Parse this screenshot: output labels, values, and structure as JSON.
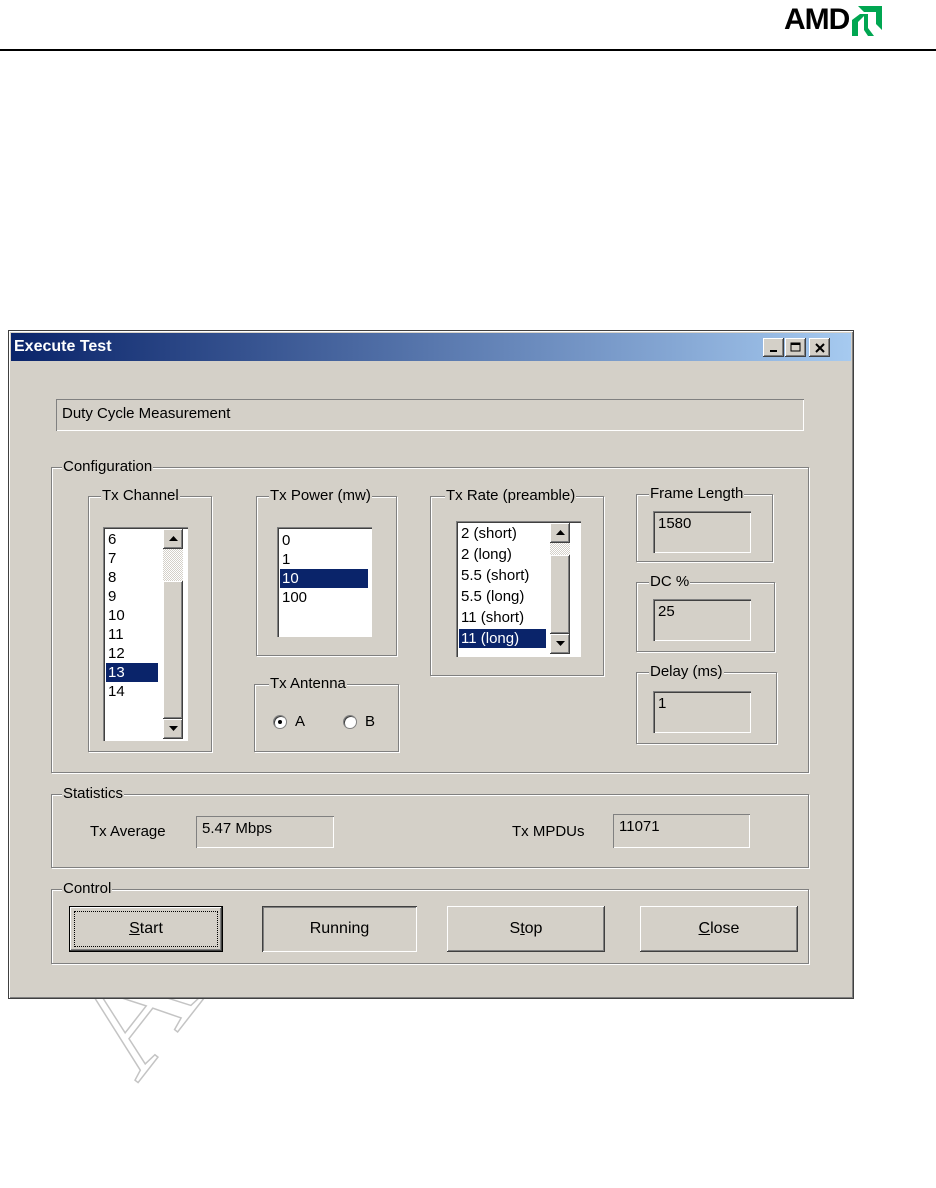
{
  "header": {
    "logo": "AMD"
  },
  "watermark": "AMD",
  "window": {
    "title": "Execute Test",
    "controls": {
      "minimize": "_",
      "maximize": "□",
      "close": "✕"
    }
  },
  "test_name": "Duty Cycle Measurement",
  "configuration": {
    "label": "Configuration",
    "tx_channel": {
      "label": "Tx Channel",
      "items": [
        "6",
        "7",
        "8",
        "9",
        "10",
        "11",
        "12",
        "13",
        "14"
      ],
      "selected": "13"
    },
    "tx_power": {
      "label": "Tx Power (mw)",
      "items": [
        "0",
        "1",
        "10",
        "100"
      ],
      "selected": "10"
    },
    "tx_rate": {
      "label": "Tx Rate (preamble)",
      "items": [
        "2 (short)",
        "2 (long)",
        "5.5 (short)",
        "5.5 (long)",
        "11 (short)",
        "11 (long)"
      ],
      "selected": "11 (long)"
    },
    "tx_antenna": {
      "label": "Tx Antenna",
      "options": [
        "A",
        "B"
      ],
      "selected": "A"
    },
    "frame_length": {
      "label": "Frame Length",
      "value": "1580"
    },
    "dc_percent": {
      "label": "DC %",
      "value": "25"
    },
    "delay": {
      "label": "Delay (ms)",
      "value": "1"
    }
  },
  "statistics": {
    "label": "Statistics",
    "tx_average": {
      "label": "Tx Average",
      "value": "5.47 Mbps"
    },
    "tx_mpdus": {
      "label": "Tx MPDUs",
      "value": "11071"
    }
  },
  "control": {
    "label": "Control",
    "start": {
      "underline": "S",
      "rest": "tart"
    },
    "running": "Running",
    "stop": {
      "pre": "S",
      "underline": "t",
      "rest": "op"
    },
    "close": {
      "underline": "C",
      "rest": "lose"
    }
  }
}
